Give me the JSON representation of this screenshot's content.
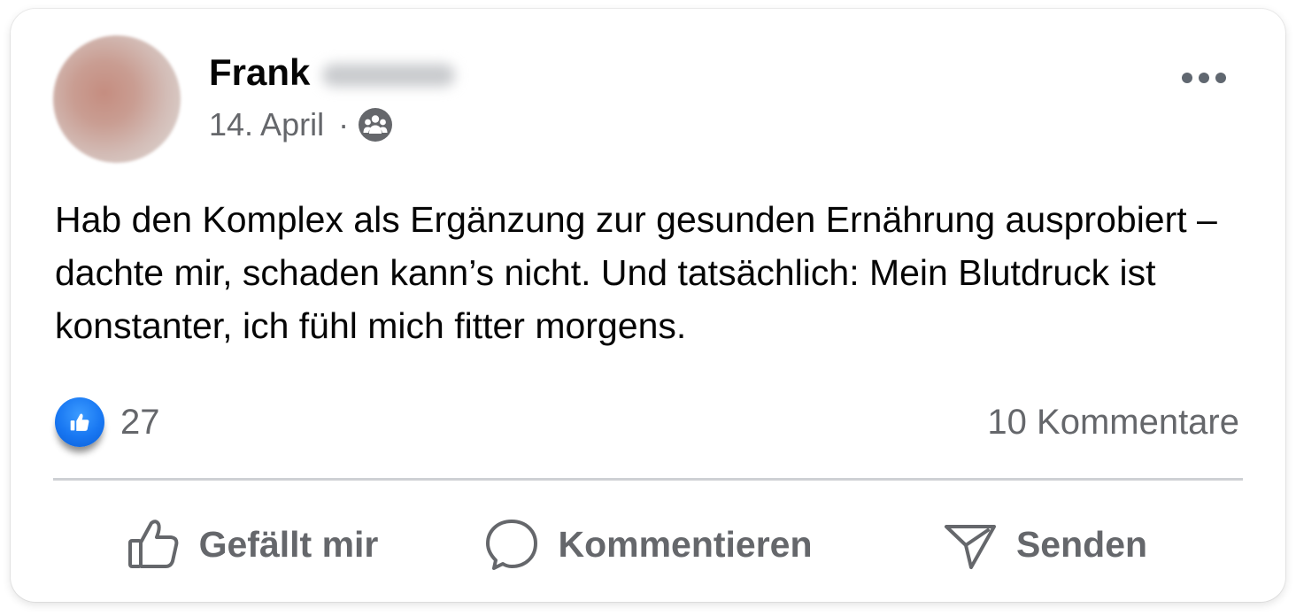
{
  "post": {
    "author_name": "Frank",
    "date": "14. April",
    "separator": "·",
    "audience_icon": "friends-icon",
    "text": "Hab den Komplex als Ergänzung zur gesunden Ernährung ausprobiert – dachte mir, schaden kann’s nicht. Und tatsächlich: Mein Blutdruck ist konstanter, ich fühl mich fitter morgens."
  },
  "stats": {
    "like_count": "27",
    "comments_label": "10 Kommentare"
  },
  "actions": {
    "like_label": "Gefällt mir",
    "comment_label": "Kommentieren",
    "share_label": "Senden"
  },
  "colors": {
    "accent": "#1877f2",
    "secondary_text": "#65676b",
    "primary_text": "#050505",
    "divider": "#ced0d4"
  }
}
